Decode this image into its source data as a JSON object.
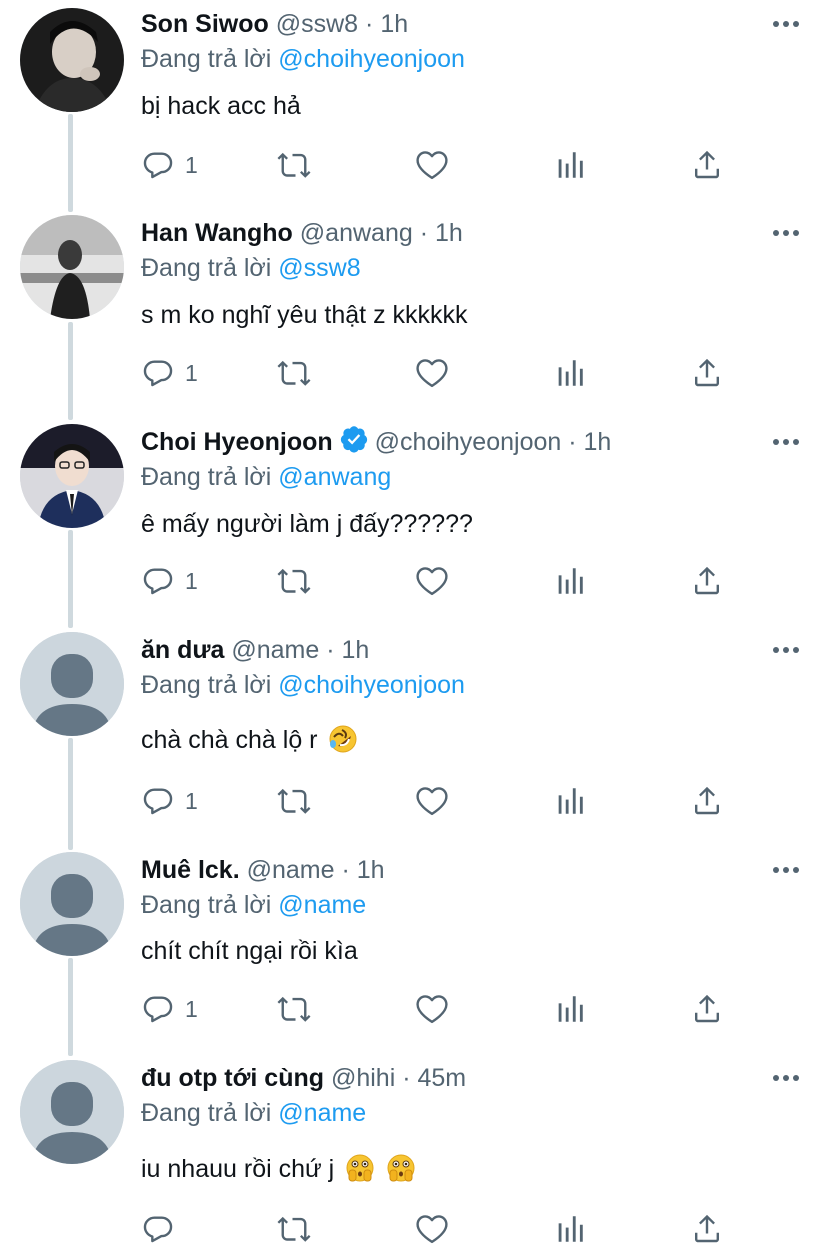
{
  "tweets": [
    {
      "name": "Son Siwoo",
      "handle": "@ssw8",
      "separator": "·",
      "time": "1h",
      "verified": false,
      "reply_prefix": "Đang trả lời",
      "reply_to": "@choihyeonjoon",
      "text": "bị hack acc hả",
      "emoji": "",
      "reply_count": "1",
      "avatar": "photo-dark"
    },
    {
      "name": "Han Wangho",
      "handle": "@anwang",
      "separator": "·",
      "time": "1h",
      "verified": false,
      "reply_prefix": "Đang trả lời",
      "reply_to": "@ssw8",
      "text": "s m ko nghĩ yêu thật z kkkkkk",
      "emoji": "",
      "reply_count": "1",
      "avatar": "photo-grey"
    },
    {
      "name": "Choi Hyeonjoon",
      "handle": "@choihyeonjoon",
      "separator": "·",
      "time": "1h",
      "verified": true,
      "reply_prefix": "Đang trả lời",
      "reply_to": "@anwang",
      "text": "ê mấy người làm j đấy??????",
      "emoji": "",
      "reply_count": "1",
      "avatar": "photo-suit"
    },
    {
      "name": "ăn dưa",
      "handle": "@name",
      "separator": "·",
      "time": "1h",
      "verified": false,
      "reply_prefix": "Đang trả lời",
      "reply_to": "@choihyeonjoon",
      "text": "chà chà chà lộ r",
      "emoji": "rolling-on-floor-laughing-emoji",
      "reply_count": "1",
      "avatar": "default"
    },
    {
      "name": "Muê lck.",
      "handle": "@name",
      "separator": "·",
      "time": "1h",
      "verified": false,
      "reply_prefix": "Đang trả lời",
      "reply_to": "@name",
      "text": "chít chít ngại rồi kìa",
      "emoji": "",
      "reply_count": "1",
      "avatar": "default"
    },
    {
      "name": "đu otp tới cùng",
      "handle": "@hihi",
      "separator": "·",
      "time": "45m",
      "verified": false,
      "reply_prefix": "Đang trả lời",
      "reply_to": "@name",
      "text": "iu nhauu rồi chứ j",
      "emoji": "flushed-hands-face-emoji x2",
      "reply_count": "",
      "avatar": "default"
    }
  ],
  "icons": {
    "reply": "reply-bubble-icon",
    "retweet": "retweet-icon",
    "like": "heart-icon",
    "analytics": "analytics-bars-icon",
    "share": "share-upload-icon",
    "more": "more-dots-icon",
    "verified": "verified-badge-icon"
  },
  "colors": {
    "text": "#0f1419",
    "secondary": "#536471",
    "link": "#1d9bf0",
    "thread_line": "#cfd9de",
    "default_avatar_bg": "#ccd6dd",
    "default_avatar_fg": "#657786"
  }
}
